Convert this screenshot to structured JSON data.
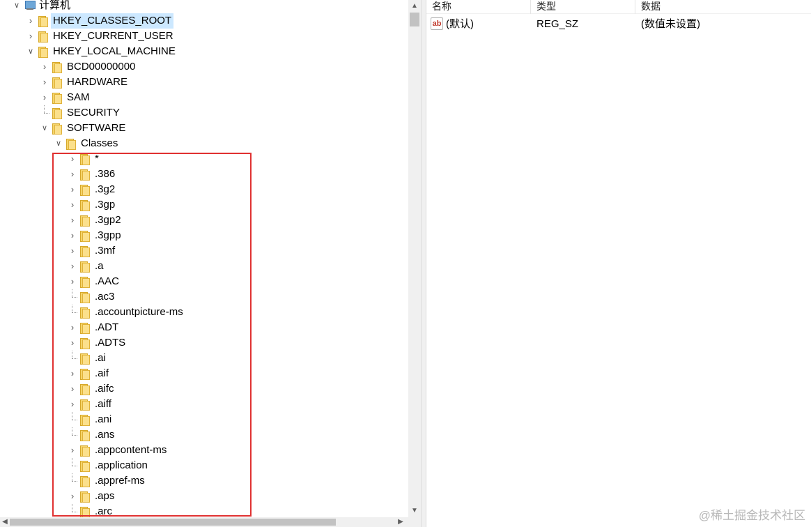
{
  "tree": {
    "nodes": [
      {
        "label": "计算机",
        "depth": 0,
        "expander": "down",
        "icon": "computer-icon"
      },
      {
        "label": "HKEY_CLASSES_ROOT",
        "depth": 1,
        "expander": "right",
        "icon": "folder-icon",
        "selected": true
      },
      {
        "label": "HKEY_CURRENT_USER",
        "depth": 1,
        "expander": "right",
        "icon": "folder-icon"
      },
      {
        "label": "HKEY_LOCAL_MACHINE",
        "depth": 1,
        "expander": "down",
        "icon": "folder-icon"
      },
      {
        "label": "BCD00000000",
        "depth": 2,
        "expander": "right",
        "icon": "folder-icon"
      },
      {
        "label": "HARDWARE",
        "depth": 2,
        "expander": "right",
        "icon": "folder-icon"
      },
      {
        "label": "SAM",
        "depth": 2,
        "expander": "right",
        "icon": "folder-icon"
      },
      {
        "label": "SECURITY",
        "depth": 2,
        "expander": "none",
        "icon": "folder-icon"
      },
      {
        "label": "SOFTWARE",
        "depth": 2,
        "expander": "down",
        "icon": "folder-icon"
      },
      {
        "label": "Classes",
        "depth": 3,
        "expander": "down",
        "icon": "folder-icon"
      },
      {
        "label": "*",
        "depth": 4,
        "expander": "right",
        "icon": "folder-icon"
      },
      {
        "label": ".386",
        "depth": 4,
        "expander": "right",
        "icon": "folder-icon"
      },
      {
        "label": ".3g2",
        "depth": 4,
        "expander": "right",
        "icon": "folder-icon"
      },
      {
        "label": ".3gp",
        "depth": 4,
        "expander": "right",
        "icon": "folder-icon"
      },
      {
        "label": ".3gp2",
        "depth": 4,
        "expander": "right",
        "icon": "folder-icon"
      },
      {
        "label": ".3gpp",
        "depth": 4,
        "expander": "right",
        "icon": "folder-icon"
      },
      {
        "label": ".3mf",
        "depth": 4,
        "expander": "right",
        "icon": "folder-icon"
      },
      {
        "label": ".a",
        "depth": 4,
        "expander": "right",
        "icon": "folder-icon"
      },
      {
        "label": ".AAC",
        "depth": 4,
        "expander": "right",
        "icon": "folder-icon"
      },
      {
        "label": ".ac3",
        "depth": 4,
        "expander": "none",
        "icon": "folder-icon"
      },
      {
        "label": ".accountpicture-ms",
        "depth": 4,
        "expander": "none",
        "icon": "folder-icon"
      },
      {
        "label": ".ADT",
        "depth": 4,
        "expander": "right",
        "icon": "folder-icon"
      },
      {
        "label": ".ADTS",
        "depth": 4,
        "expander": "right",
        "icon": "folder-icon"
      },
      {
        "label": ".ai",
        "depth": 4,
        "expander": "none",
        "icon": "folder-icon"
      },
      {
        "label": ".aif",
        "depth": 4,
        "expander": "right",
        "icon": "folder-icon"
      },
      {
        "label": ".aifc",
        "depth": 4,
        "expander": "right",
        "icon": "folder-icon"
      },
      {
        "label": ".aiff",
        "depth": 4,
        "expander": "right",
        "icon": "folder-icon"
      },
      {
        "label": ".ani",
        "depth": 4,
        "expander": "none",
        "icon": "folder-icon"
      },
      {
        "label": ".ans",
        "depth": 4,
        "expander": "none",
        "icon": "folder-icon"
      },
      {
        "label": ".appcontent-ms",
        "depth": 4,
        "expander": "right",
        "icon": "folder-icon"
      },
      {
        "label": ".application",
        "depth": 4,
        "expander": "none",
        "icon": "folder-icon"
      },
      {
        "label": ".appref-ms",
        "depth": 4,
        "expander": "none",
        "icon": "folder-icon"
      },
      {
        "label": ".aps",
        "depth": 4,
        "expander": "right",
        "icon": "folder-icon"
      },
      {
        "label": ".arc",
        "depth": 4,
        "expander": "none",
        "icon": "folder-icon"
      }
    ]
  },
  "list": {
    "columns": [
      {
        "label": "名称"
      },
      {
        "label": "类型"
      },
      {
        "label": "数据"
      }
    ],
    "rows": [
      {
        "icon": "string-value-icon",
        "icon_text": "ab",
        "name": "(默认)",
        "type": "REG_SZ",
        "data": "(数值未设置)"
      }
    ]
  },
  "watermark": "@稀土掘金技术社区",
  "colors": {
    "selection": "#cce8ff",
    "highlight_box": "#e03131",
    "folder": "#f5d46a"
  }
}
